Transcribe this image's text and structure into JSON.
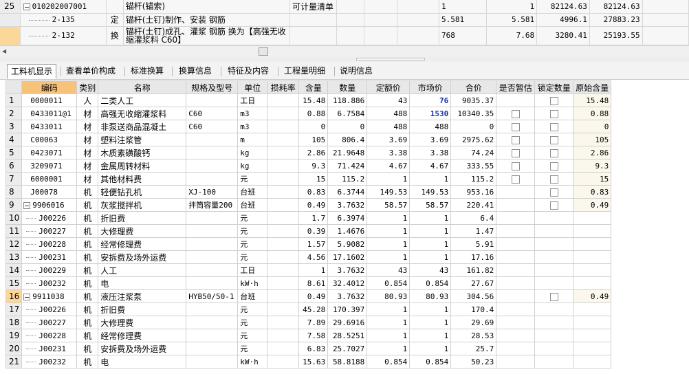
{
  "top": {
    "rows": [
      {
        "rownum": "25",
        "code": "010202007001",
        "kind": "",
        "name": "锚杆(锚索)",
        "unit": "可计量清单",
        "c1": "",
        "c2": "",
        "qty": "1",
        "q2": "1",
        "price": "82124.63",
        "total": "82124.63",
        "tree": "minus"
      },
      {
        "rownum": "",
        "code": "2-135",
        "kind": "定",
        "name": "锚杆(土钉)制作、安装 钢筋",
        "unit": "",
        "c1": "",
        "c2": "",
        "qty": "5.581",
        "q2": "5.581",
        "price": "4996.1",
        "total": "27883.23",
        "tree": "child"
      },
      {
        "rownum": "",
        "code": "2-132",
        "kind": "换",
        "name": "锚杆(土钉)成孔、灌浆 钢筋  换为【高强无收缩灌浆料  C60】",
        "unit": "",
        "c1": "",
        "c2": "",
        "qty": "768",
        "q2": "7.68",
        "price": "3280.41",
        "total": "25193.55",
        "tree": "child"
      }
    ]
  },
  "tabs": [
    {
      "label": "工料机显示",
      "active": true
    },
    {
      "label": "查看单价构成",
      "active": false
    },
    {
      "label": "标准换算",
      "active": false
    },
    {
      "label": "换算信息",
      "active": false
    },
    {
      "label": "特征及内容",
      "active": false
    },
    {
      "label": "工程量明细",
      "active": false
    },
    {
      "label": "说明信息",
      "active": false
    }
  ],
  "grid": {
    "headers": [
      "编码",
      "类别",
      "名称",
      "规格及型号",
      "单位",
      "损耗率",
      "含量",
      "数量",
      "定额价",
      "市场价",
      "合价",
      "是否暂估",
      "锁定数量",
      "原始含量"
    ],
    "rows": [
      {
        "n": "1",
        "code": "0000011",
        "type": "人",
        "name": "二类人工",
        "spec": "",
        "unit": "工日",
        "loss": "",
        "content": "15.48",
        "qty": "118.886",
        "quota": "43",
        "market": "76",
        "total": "9035.37",
        "est": false,
        "lock": true,
        "orig": "15.48"
      },
      {
        "n": "2",
        "code": "0433011@1",
        "type": "材",
        "name": "高强无收缩灌浆料",
        "spec": "C60",
        "unit": "m3",
        "loss": "",
        "content": "0.88",
        "qty": "6.7584",
        "quota": "488",
        "market": "1530",
        "total": "10340.35",
        "est": true,
        "lock": true,
        "orig": "0.88"
      },
      {
        "n": "3",
        "code": "0433011",
        "type": "材",
        "name": "非泵送商品混凝土",
        "spec": "C60",
        "unit": "m3",
        "loss": "",
        "content": "0",
        "qty": "0",
        "quota": "488",
        "market": "488",
        "total": "0",
        "est": true,
        "lock": true,
        "orig": "0"
      },
      {
        "n": "4",
        "code": "C00063",
        "type": "材",
        "name": "塑料注浆管",
        "spec": "",
        "unit": "m",
        "loss": "",
        "content": "105",
        "qty": "806.4",
        "quota": "3.69",
        "market": "3.69",
        "total": "2975.62",
        "est": true,
        "lock": true,
        "orig": "105"
      },
      {
        "n": "5",
        "code": "0423071",
        "type": "材",
        "name": "木质素磺酸钙",
        "spec": "",
        "unit": "kg",
        "loss": "",
        "content": "2.86",
        "qty": "21.9648",
        "quota": "3.38",
        "market": "3.38",
        "total": "74.24",
        "est": true,
        "lock": true,
        "orig": "2.86"
      },
      {
        "n": "6",
        "code": "3209071",
        "type": "材",
        "name": "金属周转材料",
        "spec": "",
        "unit": "kg",
        "loss": "",
        "content": "9.3",
        "qty": "71.424",
        "quota": "4.67",
        "market": "4.67",
        "total": "333.55",
        "est": true,
        "lock": true,
        "orig": "9.3"
      },
      {
        "n": "7",
        "code": "6000001",
        "type": "材",
        "name": "其他材料费",
        "spec": "",
        "unit": "元",
        "loss": "",
        "content": "15",
        "qty": "115.2",
        "quota": "1",
        "market": "1",
        "total": "115.2",
        "est": true,
        "lock": true,
        "orig": "15"
      },
      {
        "n": "8",
        "code": "J00078",
        "type": "机",
        "name": "轻便钻孔机",
        "spec": "XJ-100",
        "unit": "台班",
        "loss": "",
        "content": "0.83",
        "qty": "6.3744",
        "quota": "149.53",
        "market": "149.53",
        "total": "953.16",
        "est": false,
        "lock": true,
        "orig": "0.83"
      },
      {
        "n": "9",
        "code": "9906016",
        "type": "机",
        "name": "灰浆搅拌机",
        "spec": "拌筒容量200",
        "unit": "台班",
        "loss": "",
        "content": "0.49",
        "qty": "3.7632",
        "quota": "58.57",
        "market": "58.57",
        "total": "220.41",
        "est": false,
        "lock": true,
        "orig": "0.49",
        "tree": "minus"
      },
      {
        "n": "10",
        "code": "J00226",
        "type": "机",
        "name": "折旧费",
        "spec": "",
        "unit": "元",
        "loss": "",
        "content": "1.7",
        "qty": "6.3974",
        "quota": "1",
        "market": "1",
        "total": "6.4",
        "tree": "child"
      },
      {
        "n": "11",
        "code": "J00227",
        "type": "机",
        "name": "大修理费",
        "spec": "",
        "unit": "元",
        "loss": "",
        "content": "0.39",
        "qty": "1.4676",
        "quota": "1",
        "market": "1",
        "total": "1.47",
        "tree": "child"
      },
      {
        "n": "12",
        "code": "J00228",
        "type": "机",
        "name": "经常修理费",
        "spec": "",
        "unit": "元",
        "loss": "",
        "content": "1.57",
        "qty": "5.9082",
        "quota": "1",
        "market": "1",
        "total": "5.91",
        "tree": "child"
      },
      {
        "n": "13",
        "code": "J00231",
        "type": "机",
        "name": "安拆费及场外运费",
        "spec": "",
        "unit": "元",
        "loss": "",
        "content": "4.56",
        "qty": "17.1602",
        "quota": "1",
        "market": "1",
        "total": "17.16",
        "tree": "child"
      },
      {
        "n": "14",
        "code": "J00229",
        "type": "机",
        "name": "人工",
        "spec": "",
        "unit": "工日",
        "loss": "",
        "content": "1",
        "qty": "3.7632",
        "quota": "43",
        "market": "43",
        "total": "161.82",
        "tree": "child"
      },
      {
        "n": "15",
        "code": "J00232",
        "type": "机",
        "name": "电",
        "spec": "",
        "unit": "kW·h",
        "loss": "",
        "content": "8.61",
        "qty": "32.4012",
        "quota": "0.854",
        "market": "0.854",
        "total": "27.67",
        "tree": "child"
      },
      {
        "n": "16",
        "code": "9911038",
        "type": "机",
        "name": "液压注浆泵",
        "spec": "HYB50/50-1",
        "unit": "台班",
        "loss": "",
        "content": "0.49",
        "qty": "3.7632",
        "quota": "80.93",
        "market": "80.93",
        "total": "304.56",
        "est": false,
        "lock": true,
        "orig": "0.49",
        "tree": "minus",
        "selected": true
      },
      {
        "n": "17",
        "code": "J00226",
        "type": "机",
        "name": "折旧费",
        "spec": "",
        "unit": "元",
        "loss": "",
        "content": "45.28",
        "qty": "170.397",
        "quota": "1",
        "market": "1",
        "total": "170.4",
        "tree": "child"
      },
      {
        "n": "18",
        "code": "J00227",
        "type": "机",
        "name": "大修理费",
        "spec": "",
        "unit": "元",
        "loss": "",
        "content": "7.89",
        "qty": "29.6916",
        "quota": "1",
        "market": "1",
        "total": "29.69",
        "tree": "child"
      },
      {
        "n": "19",
        "code": "J00228",
        "type": "机",
        "name": "经常修理费",
        "spec": "",
        "unit": "元",
        "loss": "",
        "content": "7.58",
        "qty": "28.5251",
        "quota": "1",
        "market": "1",
        "total": "28.53",
        "tree": "child"
      },
      {
        "n": "20",
        "code": "J00231",
        "type": "机",
        "name": "安拆费及场外运费",
        "spec": "",
        "unit": "元",
        "loss": "",
        "content": "6.83",
        "qty": "25.7027",
        "quota": "1",
        "market": "1",
        "total": "25.7",
        "tree": "child"
      },
      {
        "n": "21",
        "code": "J00232",
        "type": "机",
        "name": "电",
        "spec": "",
        "unit": "kW·h",
        "loss": "",
        "content": "15.63",
        "qty": "58.8188",
        "quota": "0.854",
        "market": "0.854",
        "total": "50.23",
        "tree": "child"
      }
    ],
    "highlight_market_rows": [
      "1",
      "2"
    ],
    "highlight_color": "#1530b8"
  }
}
